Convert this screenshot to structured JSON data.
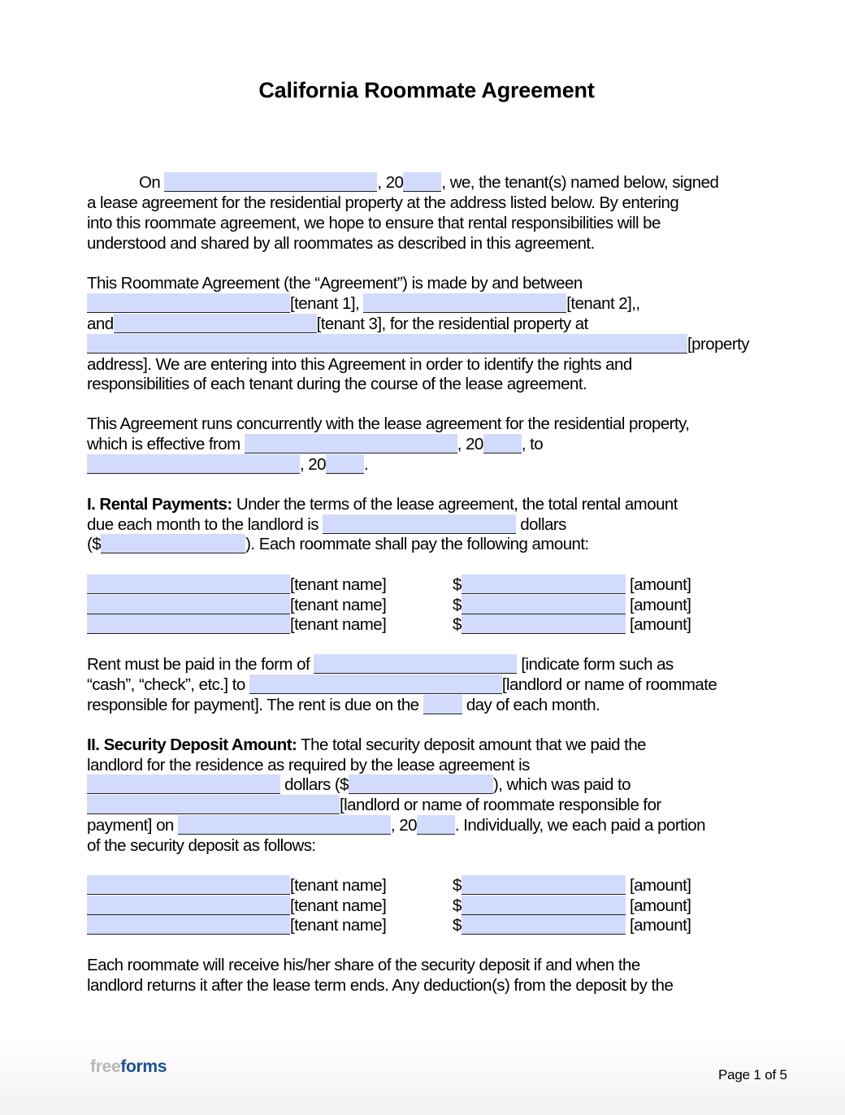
{
  "document": {
    "title": "California Roommate Agreement",
    "intro": {
      "l1_a": "On ",
      "l1_b": ", 20",
      "l1_c": ", we, the tenant(s) named below, signed",
      "l2": "a lease agreement for the residential property at the address listed below. By entering",
      "l3": "into this roommate agreement, we hope to ensure that rental responsibilities will be",
      "l4": "understood and shared by all roommates as described in this agreement."
    },
    "parties": {
      "l1": "This Roommate Agreement (the “Agreement”) is made by and between",
      "tenant1_label": "[tenant 1], ",
      "tenant2_label": "[tenant 2],,",
      "and_label": "and",
      "tenant3_label": "[tenant 3], for the residential property at",
      "property_label": "[property",
      "l5": "address]. We are entering into this Agreement in order to identify the rights and",
      "l6": "responsibilities of each tenant during the course of the lease agreement."
    },
    "term": {
      "l1": "This Agreement runs concurrently with the lease agreement for the residential property,",
      "l2_a": "which is effective from ",
      "l2_b": ", 20",
      "l2_c": ", to",
      "l3_b": ", 20",
      "l3_c": "."
    },
    "rental_payments": {
      "heading": "I.  Rental Payments:",
      "l1_rest": " Under the terms of the lease agreement, the total rental amount",
      "l2_a": "due each month to the landlord is ",
      "l2_b": " dollars",
      "l3_a": "($",
      "l3_b": ").  Each roommate shall pay the following amount:",
      "rows": [
        {
          "name_label": "[tenant name]",
          "dollar": "$",
          "amount_label": "[amount]"
        },
        {
          "name_label": "[tenant name]",
          "dollar": "$",
          "amount_label": "[amount]"
        },
        {
          "name_label": "[tenant name]",
          "dollar": "$",
          "amount_label": "[amount]"
        }
      ],
      "form_l1_a": "Rent must be paid in the form of ",
      "form_l1_b": " [indicate form such as",
      "form_l2_a": "“cash”, “check”, etc.] to ",
      "form_l2_b": "[landlord or name of roommate",
      "form_l3_a": "responsible for payment]. The rent is due on the ",
      "form_l3_b": " day of each month."
    },
    "security_deposit": {
      "heading": "II.  Security Deposit Amount:",
      "l1_rest": " The total security deposit amount that we paid the",
      "l2": "landlord for the residence as required by the lease agreement is",
      "l3_b": " dollars ($",
      "l3_c": "), which was paid to",
      "l4_b": "[landlord or name of roommate responsible for",
      "l5_a": "payment] on ",
      "l5_b": ", 20",
      "l5_c": ". Individually, we each paid a portion",
      "l6": "of the security deposit as follows:",
      "rows": [
        {
          "name_label": "[tenant name]",
          "dollar": "$",
          "amount_label": "[amount]"
        },
        {
          "name_label": "[tenant name]",
          "dollar": "$",
          "amount_label": "[amount]"
        },
        {
          "name_label": "[tenant name]",
          "dollar": "$",
          "amount_label": "[amount]"
        }
      ],
      "p2_l1": "Each roommate will receive his/her share of the security deposit if and when the",
      "p2_l2": "landlord returns it after the lease term ends. Any deduction(s) from the deposit by the"
    }
  },
  "footer": {
    "logo_free": "free",
    "logo_forms": "forms",
    "page_label": "Page 1 of 5"
  },
  "colors": {
    "field_fill": "#d3dbfd",
    "logo_gray": "#b8b8b8",
    "logo_blue": "#1b4f91"
  }
}
